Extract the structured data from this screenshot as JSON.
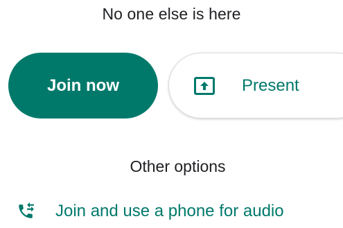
{
  "status": {
    "message": "No one else is here"
  },
  "actions": {
    "join_label": "Join now",
    "present_label": "Present"
  },
  "other_options": {
    "heading": "Other options",
    "phone_audio_label": "Join and use a phone for audio"
  },
  "icons": {
    "present": "present-screen-icon",
    "phone": "phone-forwarded-icon"
  },
  "colors": {
    "accent": "#00796b",
    "text": "#202124",
    "button_text": "#ffffff"
  }
}
